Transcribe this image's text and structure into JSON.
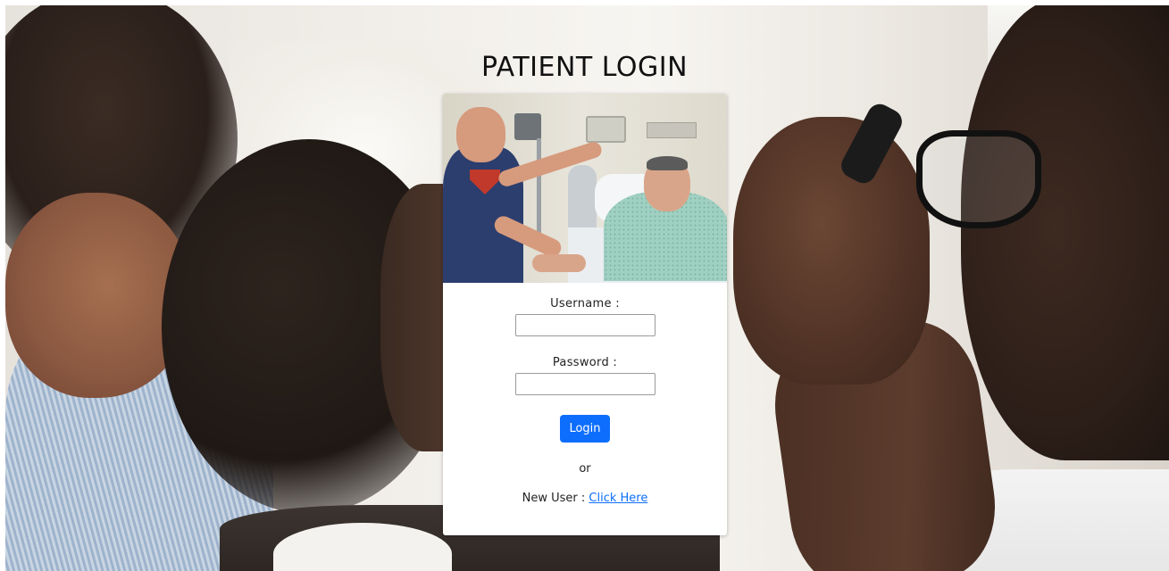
{
  "page": {
    "title": "PATIENT LOGIN"
  },
  "form": {
    "username_label": "Username :",
    "username_value": "",
    "password_label": "Password :",
    "password_value": "",
    "login_label": "Login",
    "or_text": "or",
    "new_user_text": "New User :",
    "new_user_link": "Click Here"
  },
  "colors": {
    "primary": "#0d6efd",
    "card_bg": "#ffffff",
    "title_text": "#111111"
  }
}
